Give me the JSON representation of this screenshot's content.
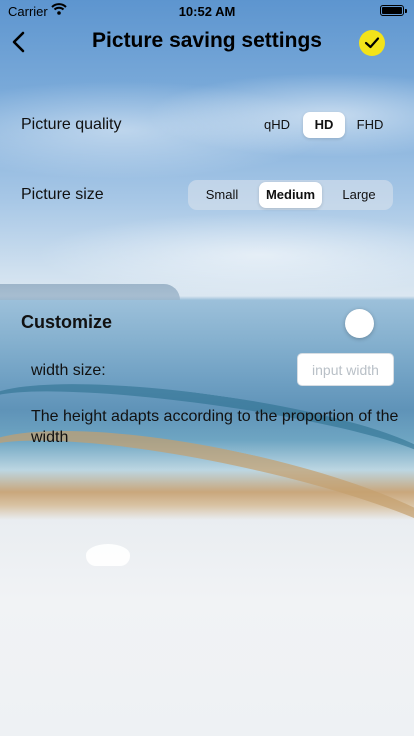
{
  "status_bar": {
    "carrier": "Carrier",
    "time": "10:52 AM",
    "wifi_icon": "wifi-icon",
    "battery_icon": "battery-icon"
  },
  "nav": {
    "back_icon": "chevron-left-icon",
    "title": "Picture saving settings",
    "confirm_icon": "checkmark-circle-icon",
    "confirm_color": "#f3e31a"
  },
  "quality": {
    "label": "Picture quality",
    "options": [
      "qHD",
      "HD",
      "FHD"
    ],
    "selected": "HD"
  },
  "size": {
    "label": "Picture size",
    "options": [
      "Small",
      "Medium",
      "Large"
    ],
    "selected": "Medium"
  },
  "customize": {
    "label": "Customize",
    "enabled": false,
    "width_label": "width size:",
    "width_value": "",
    "width_placeholder": "input width",
    "note": "The height adapts according to the proportion of the width"
  }
}
